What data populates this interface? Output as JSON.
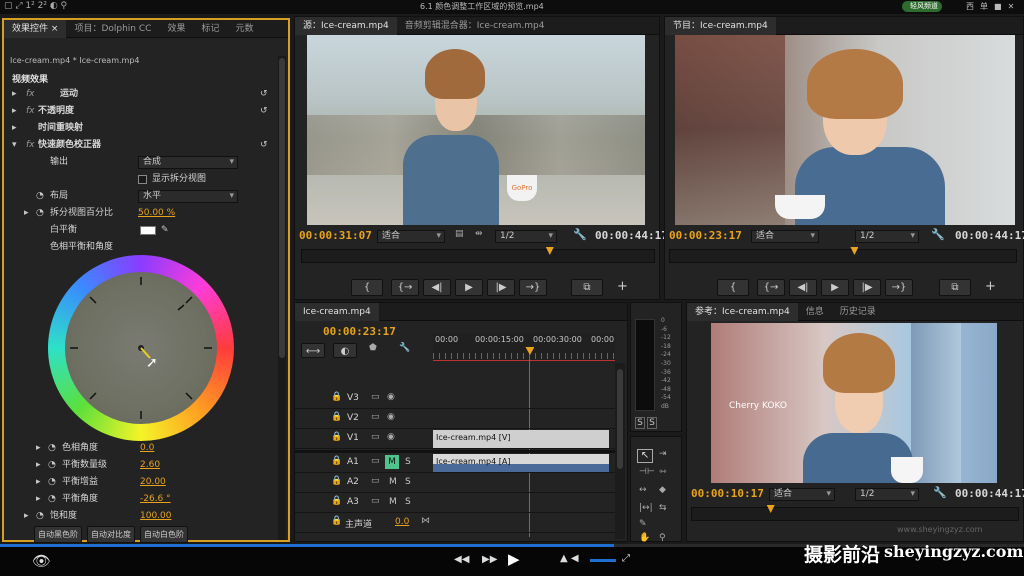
{
  "titlebar": {
    "title": "6.1 颜色调整工作区域的预览.mp4",
    "right_status": "轻风频道",
    "right_items": [
      "西",
      "单",
      "■",
      "✕"
    ]
  },
  "effects": {
    "tabs": [
      "效果控件",
      "项目：Dolphin CC",
      "效果",
      "标记",
      "元数"
    ],
    "close_mark": "×",
    "clip_header": "Ice-cream.mp4 * Ice-cream.mp4",
    "section": "视频效果",
    "fx_rows": [
      {
        "fx": "fx",
        "name": "运动"
      },
      {
        "fx": "fx",
        "name": "不透明度"
      },
      {
        "fx": "",
        "name": "时间重映射"
      },
      {
        "fx": "fx",
        "name": "快速颜色校正器"
      }
    ],
    "output_label": "输出",
    "output_value": "合成",
    "split_view_label": "显示拆分视图",
    "layout_label": "布局",
    "layout_value": "水平",
    "split_percent_label": "拆分视图百分比",
    "split_percent_value": "50.00 %",
    "white_balance_label": "白平衡",
    "hue_balance_label": "色相平衡和角度",
    "params": [
      {
        "label": "色相角度",
        "value": "0.0"
      },
      {
        "label": "平衡数量级",
        "value": "2.60"
      },
      {
        "label": "平衡增益",
        "value": "20.00"
      },
      {
        "label": "平衡角度",
        "value": "-26.6 °"
      }
    ],
    "saturation_label": "饱和度",
    "saturation_value": "100.00",
    "auto_buttons": [
      "自动黑色阶",
      "自动对比度",
      "自动白色阶"
    ]
  },
  "source": {
    "tabs": [
      "源：Ice-cream.mp4",
      "音频剪辑混合器：Ice-cream.mp4"
    ],
    "timecode": "00:00:31:07",
    "fit": "适合",
    "resolution": "1/2",
    "duration": "00:00:44:17",
    "playhead": 0.7,
    "image_text": "GoPro"
  },
  "program": {
    "tabs": [
      "节目：Ice-cream.mp4"
    ],
    "timecode": "00:00:23:17",
    "fit": "适合",
    "resolution": "1/2",
    "duration": "00:00:44:17",
    "playhead": 0.53
  },
  "reference": {
    "tabs": [
      "参考：Ice-cream.mp4",
      "信息",
      "历史记录"
    ],
    "timecode": "00:00:10:17",
    "fit": "适合",
    "resolution": "1/2",
    "duration": "00:00:44:17",
    "playhead": 0.24,
    "image_text": "Cherry KOKO",
    "watermark": "www.sheyingzyz.com"
  },
  "timeline": {
    "tab": "Ice-cream.mp4",
    "timecode": "00:00:23:17",
    "ruler": [
      "00:00",
      "00:00:15:00",
      "00:00:30:00",
      "00:00"
    ],
    "playhead": 0.53,
    "video_tracks": [
      "V3",
      "V2",
      "V1"
    ],
    "audio_tracks": [
      "A1",
      "A2",
      "A3"
    ],
    "mute_label": "M",
    "solo_label": "S",
    "master_label": "主声道",
    "master_value": "0.0",
    "video_clip": "Ice-cream.mp4 [V]",
    "audio_clip": "Ice-cream.mp4 [A]"
  },
  "meter": {
    "labels": [
      "0",
      "-6",
      "-12",
      "-18",
      "-24",
      "-30",
      "-36",
      "-42",
      "-48",
      "-54",
      "dB"
    ],
    "solo": [
      "S",
      "S"
    ]
  },
  "transport_buttons": [
    "{",
    "{→",
    "◀|",
    "▶",
    "|▶",
    "→}",
    "⧉"
  ],
  "brand": {
    "cn": "摄影前沿",
    "url": "sheyingzyz.com"
  }
}
